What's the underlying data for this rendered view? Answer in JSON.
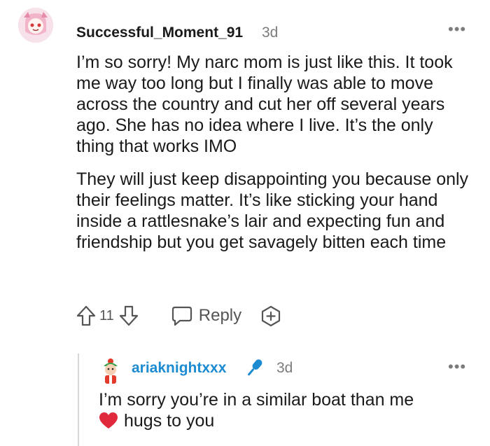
{
  "comment": {
    "username": "Successful_Moment_91",
    "time": "3d",
    "paragraphs": [
      "I’m so sorry! My narc mom is just like this. It took me way too long but I finally was able to move across the country and cut her off several years ago. She has no idea where I live. It’s the only thing that works IMO",
      "They will just keep disappointing you because only their feelings matter. It’s like sticking your hand inside a rattlesnake’s lair and expecting fun and friendship but you get savagely bitten each time"
    ],
    "votes": "11",
    "reply_label": "Reply"
  },
  "reply": {
    "username": "ariaknightxxx",
    "time": "3d",
    "text_line1": "I’m sorry you’re in a similar boat than me",
    "text_line2": "hugs to you"
  },
  "icons": {
    "more": "more-options-icon",
    "upvote": "upvote-arrow-icon",
    "downvote": "downvote-arrow-icon",
    "reply": "reply-bubble-icon",
    "award": "award-plus-icon",
    "mic": "microphone-icon",
    "heart": "heart-icon"
  },
  "colors": {
    "reply_username": "#1c8bd1",
    "heart": "#e0293c",
    "mic": "#1c8bd1"
  }
}
